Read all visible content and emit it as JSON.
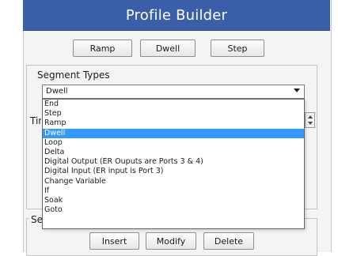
{
  "app": {
    "title": "Profile Builder"
  },
  "toolbar": {
    "ramp": "Ramp",
    "dwell": "Dwell",
    "step": "Step"
  },
  "segment_types": {
    "label": "Segment Types",
    "selected": "Dwell",
    "options": [
      "End",
      "Step",
      "Ramp",
      "Dwell",
      "Loop",
      "Delta",
      "Digital Output (ER Ouputs are Ports 3 & 4)",
      "Digital Input (ER input is Port 3)",
      "Change Variable",
      "If",
      "Soak",
      "Goto"
    ],
    "highlighted_index": 3
  },
  "clipped": {
    "time_label": "Tin",
    "segments_label": "Se"
  },
  "actions": {
    "insert": "Insert",
    "modify": "Modify",
    "delete": "Delete"
  }
}
